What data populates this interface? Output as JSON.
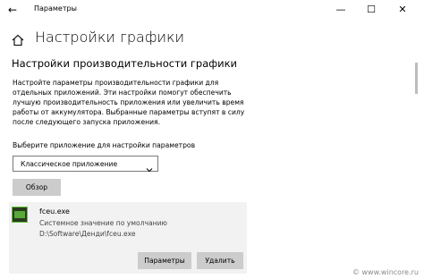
{
  "window": {
    "title": "Параметры",
    "back_glyph": "←",
    "min_glyph": "—",
    "max_glyph": "☐",
    "close_glyph": "✕"
  },
  "page": {
    "title": "Настройки графики",
    "section_title": "Настройки производительности графики",
    "description": "Настройте параметры производительности графики для отдельных приложений. Эти настройки помогут обеспечить лучшую производительность приложения или увеличить время работы от аккумулятора. Выбранные параметры вступят в силу после следующего запуска приложения.",
    "select_label": "Выберите приложение для настройки параметров"
  },
  "app_type": {
    "selected": "Классическое приложение"
  },
  "browse": {
    "label": "Обзор"
  },
  "app_entry": {
    "name": "fceu.exe",
    "setting": "Системное значение по умолчанию",
    "path": "D:\\Software\\Денди\\fceu.exe",
    "options_label": "Параметры",
    "remove_label": "Удалить"
  },
  "watermark": "© www.wincore.ru",
  "icons": {
    "home": "home-icon",
    "chevron": "chevron-down-icon",
    "app": "app-icon"
  }
}
